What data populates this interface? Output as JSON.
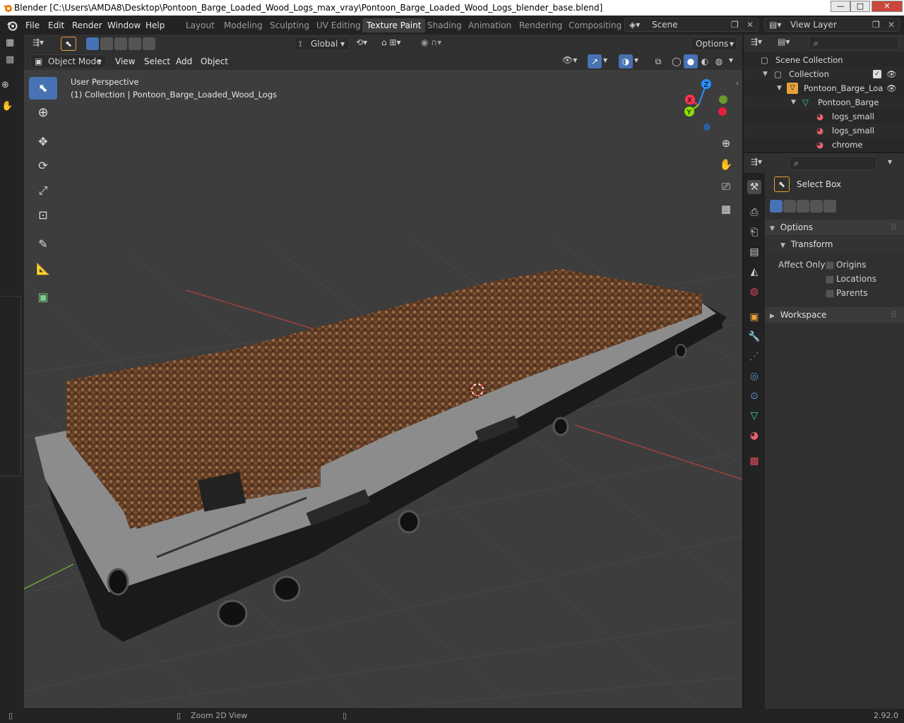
{
  "window": {
    "title": "Blender [C:\\Users\\AMDA8\\Desktop\\Pontoon_Barge_Loaded_Wood_Logs_max_vray\\Pontoon_Barge_Loaded_Wood_Logs_blender_base.blend]",
    "minimize": "—",
    "maximize": "□",
    "close": "✕"
  },
  "menu": {
    "file": "File",
    "edit": "Edit",
    "render": "Render",
    "window": "Window",
    "help": "Help"
  },
  "workspaces": [
    {
      "label": "Layout",
      "active": false
    },
    {
      "label": "Modeling",
      "active": false
    },
    {
      "label": "Sculpting",
      "active": false
    },
    {
      "label": "UV Editing",
      "active": false
    },
    {
      "label": "Texture Paint",
      "active": true
    },
    {
      "label": "Shading",
      "active": false
    },
    {
      "label": "Animation",
      "active": false
    },
    {
      "label": "Rendering",
      "active": false
    },
    {
      "label": "Compositing",
      "active": false
    }
  ],
  "scene": {
    "label": "Scene"
  },
  "view_layer": {
    "label": "View Layer"
  },
  "tool_header": {
    "orientation": "Global",
    "options": "Options"
  },
  "viewport_header": {
    "mode": "Object Mode",
    "view": "View",
    "select": "Select",
    "add": "Add",
    "object": "Object"
  },
  "viewport": {
    "perspective": "User Perspective",
    "collection_info": "(1) Collection | Pontoon_Barge_Loaded_Wood_Logs",
    "gizmo": {
      "x": "X",
      "y": "Y",
      "z": "Z"
    }
  },
  "outliner": {
    "scene_collection": "Scene Collection",
    "collection": "Collection",
    "object": "Pontoon_Barge_Loa",
    "mesh": "Pontoon_Barge",
    "materials": [
      "logs_small",
      "logs_small",
      "chrome"
    ]
  },
  "properties": {
    "tool_name": "Select Box",
    "options": "Options",
    "transform": "Transform",
    "affect_only": "Affect Only",
    "origins": "Origins",
    "locations": "Locations",
    "parents": "Parents",
    "workspace": "Workspace"
  },
  "statusbar": {
    "hint": "Zoom 2D View",
    "version": "2.92.0"
  },
  "colors": {
    "accent": "#4772b3",
    "x_axis": "#ff3352",
    "y_axis": "#8bdc00",
    "z_axis": "#2890ff"
  }
}
